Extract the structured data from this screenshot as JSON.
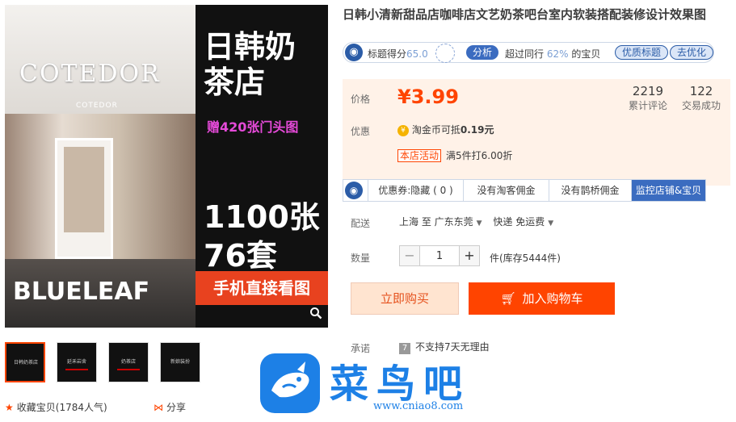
{
  "gallery": {
    "photo_logo_big": "COTEDOR",
    "photo_logo_small": "COTEDOR",
    "photo_brand": "BLUELEAF",
    "promo_title": "日韩奶茶店",
    "promo_sub": "赠420张门头图",
    "promo_count1": "1100张",
    "promo_count2": "76套",
    "promo_button": "手机直接看图",
    "zoom_icon": "search-icon",
    "thumbnails": [
      {
        "text": "日韩奶茶店"
      },
      {
        "text": "延禾岩舍"
      },
      {
        "text": "奶茶店"
      },
      {
        "text": "新娘装扮"
      }
    ]
  },
  "bottom": {
    "favorite_label": "收藏宝贝",
    "favorite_count": "(1784人气)",
    "share_label": "分享"
  },
  "product": {
    "title": "日韩小清新甜品店咖啡店文艺奶茶吧台室内软装搭配装修设计效果图"
  },
  "rating": {
    "label": "标题得分",
    "score": "65.0",
    "analyze": "分析",
    "beat_text": "超过同行",
    "beat_pct": "62%",
    "beat_suffix": "的宝贝",
    "quality_title": "优质标题",
    "optimize": "去优化"
  },
  "price": {
    "label": "价格",
    "value": "¥3.99",
    "reviews_count": "2219",
    "reviews_label": "累计评论",
    "sales_count": "122",
    "sales_label": "交易成功"
  },
  "discount": {
    "label": "优惠",
    "coin_text": "淘金币可抵",
    "coin_amount": "0.19元",
    "store_tag": "本店活动",
    "store_text": "满5件打6.00折"
  },
  "promo_bar": {
    "coupon": "优惠券:隐藏 ( 0 )",
    "no_taoke": "没有淘客佣金",
    "no_queqiao": "没有鹊桥佣金",
    "monitor": "监控店铺&宝贝"
  },
  "shipping": {
    "label": "配送",
    "from": "上海 至",
    "to": "广东东莞",
    "method": "快递 免运费"
  },
  "quantity": {
    "label": "数量",
    "minus": "−",
    "value": "1",
    "plus": "+",
    "stock": "件(库存5444件)"
  },
  "actions": {
    "buy_now": "立即购买",
    "add_cart": "加入购物车"
  },
  "promise": {
    "label": "承诺",
    "text": "不支持7天无理由"
  },
  "watermark": {
    "text": "菜鸟吧",
    "url": "www.cniao8.com"
  },
  "colors": {
    "accent": "#ff4400",
    "blue": "#3b6cc0"
  }
}
